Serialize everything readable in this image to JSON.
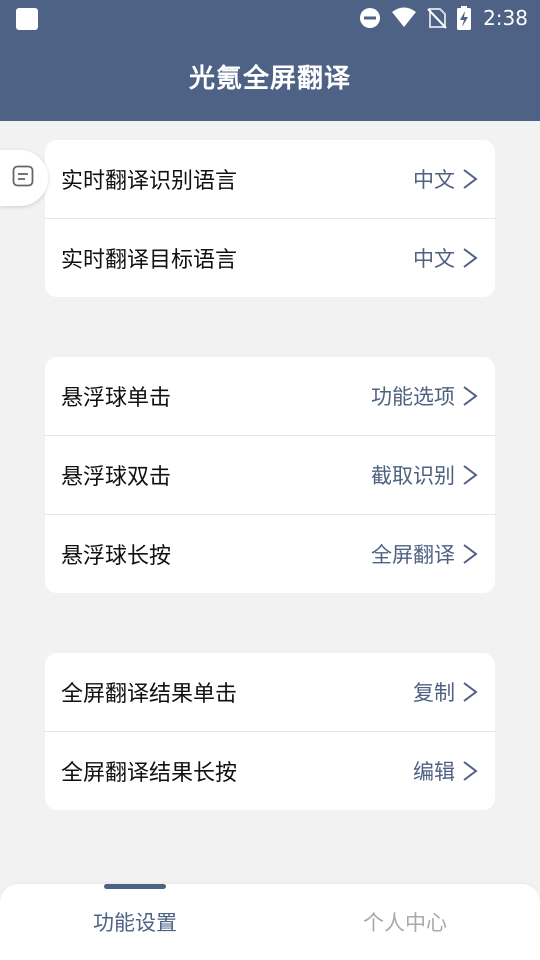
{
  "status_bar": {
    "time": "2:38",
    "icons": [
      "app-square-icon",
      "do-not-disturb-icon",
      "wifi-icon",
      "no-sim-icon",
      "battery-charging-icon"
    ]
  },
  "header": {
    "title": "光氪全屏翻译"
  },
  "side_tab": {
    "icon": "note-icon"
  },
  "groups": [
    {
      "rows": [
        {
          "label": "实时翻译识别语言",
          "value": "中文"
        },
        {
          "label": "实时翻译目标语言",
          "value": "中文"
        }
      ]
    },
    {
      "rows": [
        {
          "label": "悬浮球单击",
          "value": "功能选项"
        },
        {
          "label": "悬浮球双击",
          "value": "截取识别"
        },
        {
          "label": "悬浮球长按",
          "value": "全屏翻译"
        }
      ]
    },
    {
      "rows": [
        {
          "label": "全屏翻译结果单击",
          "value": "复制"
        },
        {
          "label": "全屏翻译结果长按",
          "value": "编辑"
        }
      ]
    }
  ],
  "bottom_nav": {
    "items": [
      {
        "label": "功能设置",
        "active": true
      },
      {
        "label": "个人中心",
        "active": false
      }
    ]
  },
  "colors": {
    "header_bg": "#4d6285",
    "value_text": "#4f6181",
    "page_bg": "#f2f2f2",
    "inactive_nav": "#a9a9a9"
  }
}
